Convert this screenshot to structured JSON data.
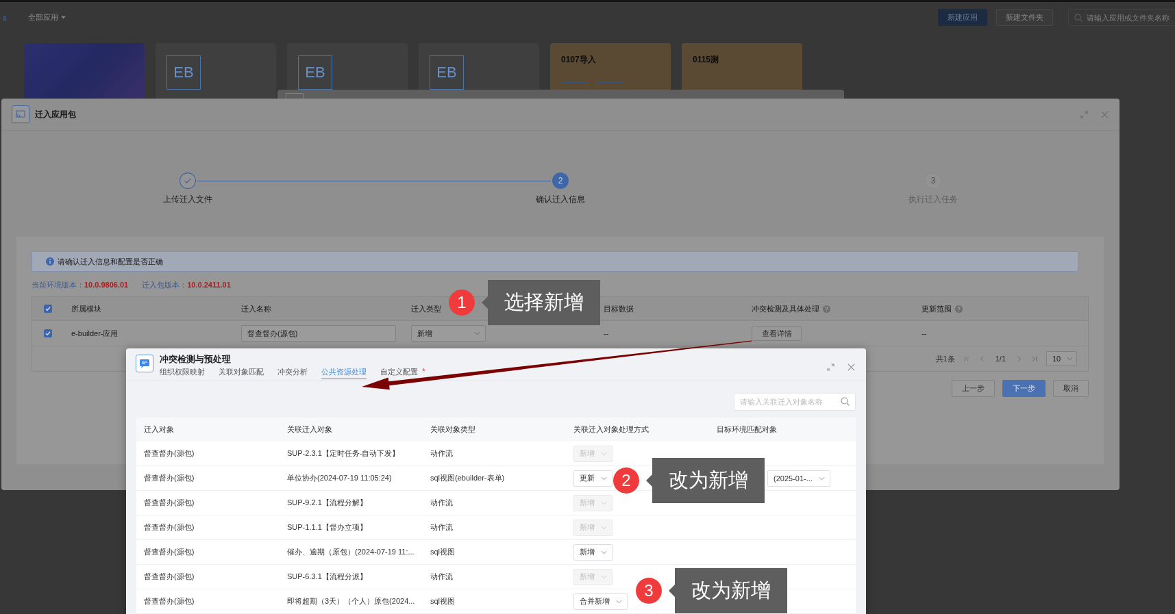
{
  "top_bar": {
    "edge_text": "s",
    "filter": "全部应用",
    "buttons": [
      {
        "label": "新建应用",
        "kind": "primary"
      },
      {
        "label": "新建文件夹",
        "kind": "default"
      }
    ],
    "search": {
      "placeholder": "请输入应用或文件夹名称"
    }
  },
  "app_cards": [
    {
      "kind": "image"
    },
    {
      "kind": "logo",
      "logo": "EB"
    },
    {
      "kind": "logo",
      "logo": "EB"
    },
    {
      "kind": "logo",
      "logo": "EB"
    },
    {
      "kind": "titled",
      "title": "0107导入",
      "has_actions": true
    },
    {
      "kind": "titled",
      "title": "0115测"
    }
  ],
  "import_dialog": {
    "title": "迁入应用包",
    "steps": [
      {
        "label": "上传迁入文件",
        "completed": true,
        "active": false
      },
      {
        "number": "2",
        "label": "确认迁入信息",
        "completed": false,
        "active": true
      },
      {
        "number": "3",
        "label": "执行迁入任务",
        "completed": false,
        "active": false
      }
    ],
    "notice": "请确认迁入信息和配置是否正确",
    "versions": [
      {
        "label": "当前环境版本：",
        "value": "10.0.9806.01"
      },
      {
        "label": "迁入包版本：",
        "value": "10.0.2411.01"
      }
    ],
    "table": {
      "all_checked": true,
      "columns": [
        {
          "label": "所属模块"
        },
        {
          "label": "迁入名称"
        },
        {
          "label": "迁入类型"
        },
        {
          "label": "目标数据"
        },
        {
          "label": "冲突检测及具体处理",
          "help": true
        },
        {
          "label": "更新范围",
          "help": true
        }
      ],
      "rows": [
        {
          "checked": true,
          "module": "e-builder-应用",
          "name": "督查督办(源包)",
          "type": "新增",
          "target": "--",
          "action": "查看详情",
          "scope": "--"
        }
      ]
    },
    "pagination": {
      "total": "共1条",
      "page": "1/1",
      "page_size": "10"
    },
    "buttons": [
      {
        "label": "上一步",
        "kind": "default"
      },
      {
        "label": "下一步",
        "kind": "primary"
      },
      {
        "label": "取消",
        "kind": "default"
      }
    ]
  },
  "conflict_dialog": {
    "title": "冲突检测与预处理",
    "tabs": [
      {
        "label": "组织权限映射",
        "selected": false
      },
      {
        "label": "关联对象匹配",
        "selected": false
      },
      {
        "label": "冲突分析",
        "selected": false
      },
      {
        "label": "公共资源处理",
        "selected": true
      },
      {
        "label": "自定义配置",
        "selected": false,
        "flag": "*"
      }
    ],
    "search": {
      "placeholder": "请输入关联迁入对象名称"
    },
    "table": {
      "columns": [
        "迁入对象",
        "关联迁入对象",
        "关联对象类型",
        "关联迁入对象处理方式",
        "目标环境匹配对象"
      ],
      "rows": [
        {
          "object": "督查督办(源包)",
          "related": "SUP-2.3.1【定时任务-自动下发】",
          "type": "动作流",
          "handling": {
            "value": "新增",
            "disabled": true
          }
        },
        {
          "object": "督查督办(源包)",
          "related": "单位协办(2024-07-19 11:05:24)",
          "type": "sql视图(ebuilder-表单)",
          "handling": {
            "value": "更新",
            "disabled": false
          },
          "target": {
            "value": "(2025-01-..."
          }
        },
        {
          "object": "督查督办(源包)",
          "related": "SUP-9.2.1【流程分解】",
          "type": "动作流",
          "handling": {
            "value": "新增",
            "disabled": true
          }
        },
        {
          "object": "督查督办(源包)",
          "related": "SUP-1.1.1【督办立项】",
          "type": "动作流",
          "handling": {
            "value": "新增",
            "disabled": true
          }
        },
        {
          "object": "督查督办(源包)",
          "related": "催办、逾期（原包）(2024-07-19 11:...",
          "type": "sql视图",
          "handling": {
            "value": "新增",
            "disabled": false
          }
        },
        {
          "object": "督查督办(源包)",
          "related": "SUP-6.3.1【流程分派】",
          "type": "动作流",
          "handling": {
            "value": "新增",
            "disabled": true
          }
        },
        {
          "object": "督查督办(源包)",
          "related": "即将超期（3天）（个人）原包(2024...",
          "type": "sql视图",
          "handling": {
            "value": "合并新增",
            "disabled": false
          }
        }
      ]
    }
  },
  "annotations": [
    {
      "number": "1",
      "text": "选择新增"
    },
    {
      "number": "2",
      "text": "改为新增"
    },
    {
      "number": "3",
      "text": "改为新增"
    }
  ]
}
